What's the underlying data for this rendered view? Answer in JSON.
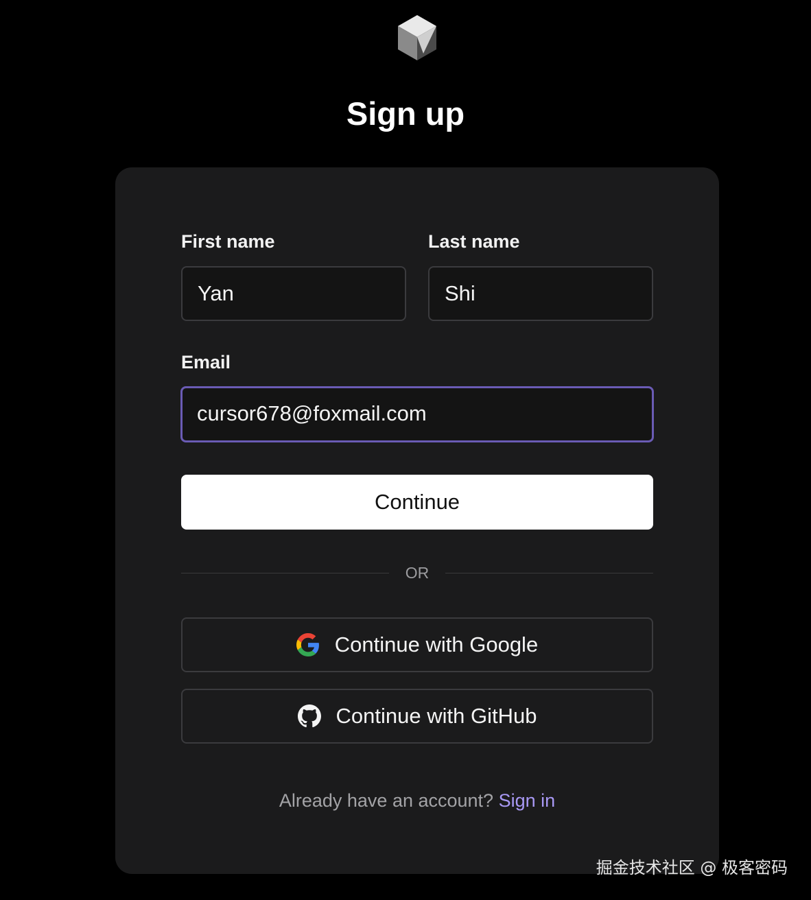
{
  "logo": {
    "icon": "cube-logo-icon"
  },
  "page_title": "Sign up",
  "form": {
    "first_name_label": "First name",
    "first_name_value": "Yan",
    "last_name_label": "Last name",
    "last_name_value": "Shi",
    "email_label": "Email",
    "email_value": "cursor678@foxmail.com",
    "continue_label": "Continue",
    "divider_text": "OR",
    "google_label": "Continue with Google",
    "github_label": "Continue with GitHub",
    "signin_prompt": "Already have an account?",
    "signin_link": "Sign in"
  },
  "colors": {
    "background": "#000000",
    "card": "#1b1b1c",
    "focus_border": "#6a5bb4",
    "link": "#a999f5"
  },
  "watermark": "掘金技术社区 @ 极客密码"
}
